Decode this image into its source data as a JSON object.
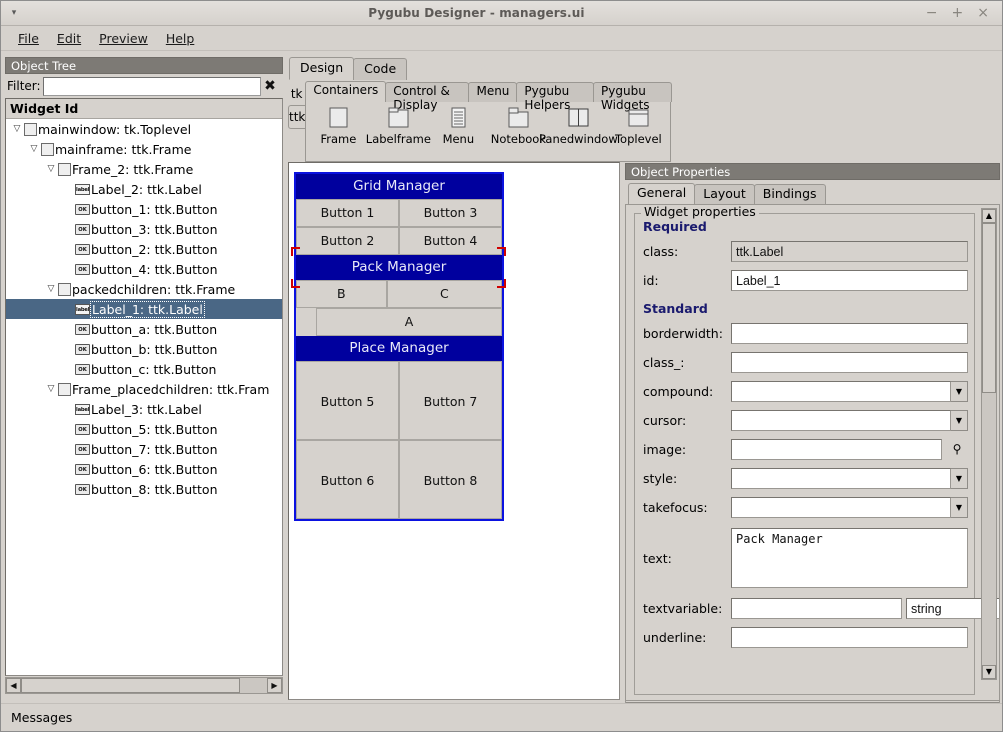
{
  "window": {
    "title": "Pygubu Designer - managers.ui",
    "controls": {
      "minimize": "−",
      "maximize": "+",
      "close": "×",
      "menu_caret": "▾"
    }
  },
  "menubar": {
    "items": [
      "File",
      "Edit",
      "Preview",
      "Help"
    ]
  },
  "object_tree": {
    "header": "Object Tree",
    "filter_label": "Filter:",
    "filter_value": "",
    "filter_placeholder": "",
    "clear_icon": "✖",
    "column_header": "Widget Id",
    "items": [
      {
        "label": "mainwindow: tk.Toplevel",
        "indent": 0,
        "twist": "▽",
        "icon": "frame",
        "selected": false
      },
      {
        "label": "mainframe: ttk.Frame",
        "indent": 1,
        "twist": "▽",
        "icon": "frame",
        "selected": false
      },
      {
        "label": "Frame_2: ttk.Frame",
        "indent": 2,
        "twist": "▽",
        "icon": "frame",
        "selected": false
      },
      {
        "label": "Label_2: ttk.Label",
        "indent": 3,
        "twist": "",
        "icon": "label",
        "selected": false
      },
      {
        "label": "button_1: ttk.Button",
        "indent": 3,
        "twist": "",
        "icon": "button",
        "selected": false
      },
      {
        "label": "button_3: ttk.Button",
        "indent": 3,
        "twist": "",
        "icon": "button",
        "selected": false
      },
      {
        "label": "button_2: ttk.Button",
        "indent": 3,
        "twist": "",
        "icon": "button",
        "selected": false
      },
      {
        "label": "button_4: ttk.Button",
        "indent": 3,
        "twist": "",
        "icon": "button",
        "selected": false
      },
      {
        "label": "packedchildren: ttk.Frame",
        "indent": 2,
        "twist": "▽",
        "icon": "frame",
        "selected": false
      },
      {
        "label": "Label_1: ttk.Label",
        "indent": 3,
        "twist": "",
        "icon": "label",
        "selected": true
      },
      {
        "label": "button_a: ttk.Button",
        "indent": 3,
        "twist": "",
        "icon": "button",
        "selected": false
      },
      {
        "label": "button_b: ttk.Button",
        "indent": 3,
        "twist": "",
        "icon": "button",
        "selected": false
      },
      {
        "label": "button_c: ttk.Button",
        "indent": 3,
        "twist": "",
        "icon": "button",
        "selected": false
      },
      {
        "label": "Frame_placedchildren: ttk.Fram",
        "indent": 2,
        "twist": "▽",
        "icon": "frame",
        "selected": false
      },
      {
        "label": "Label_3: ttk.Label",
        "indent": 3,
        "twist": "",
        "icon": "label",
        "selected": false
      },
      {
        "label": "button_5: ttk.Button",
        "indent": 3,
        "twist": "",
        "icon": "button",
        "selected": false
      },
      {
        "label": "button_7: ttk.Button",
        "indent": 3,
        "twist": "",
        "icon": "button",
        "selected": false
      },
      {
        "label": "button_6: ttk.Button",
        "indent": 3,
        "twist": "",
        "icon": "button",
        "selected": false
      },
      {
        "label": "button_8: ttk.Button",
        "indent": 3,
        "twist": "",
        "icon": "button",
        "selected": false
      }
    ],
    "icon_text": {
      "label": "label",
      "button": "OK"
    },
    "scroll_left_arrow": "◀",
    "scroll_right_arrow": "▶"
  },
  "design": {
    "tabs": [
      {
        "label": "Design",
        "active": true
      },
      {
        "label": "Code",
        "active": false
      }
    ],
    "toolkit_tabs": [
      {
        "label": "tk",
        "active": false
      },
      {
        "label": "ttk",
        "active": true
      }
    ],
    "palette_tabs": [
      {
        "label": "Containers",
        "active": true
      },
      {
        "label": "Control & Display",
        "active": false
      },
      {
        "label": "Menu",
        "active": false
      },
      {
        "label": "Pygubu Helpers",
        "active": false
      },
      {
        "label": "Pygubu Widgets",
        "active": false
      }
    ],
    "palette_items": [
      {
        "label": "Frame",
        "icon": "frame-icon"
      },
      {
        "label": "Labelframe",
        "icon": "labelframe-icon"
      },
      {
        "label": "Menu",
        "icon": "menu-icon"
      },
      {
        "label": "Notebook",
        "icon": "notebook-icon"
      },
      {
        "label": "Panedwindow",
        "icon": "panedwindow-icon"
      },
      {
        "label": "Toplevel",
        "icon": "toplevel-icon"
      }
    ],
    "canvas": {
      "selection_tag": "mainwindow",
      "grid_manager": {
        "title": "Grid Manager",
        "buttons": [
          "Button 1",
          "Button 3",
          "Button 2",
          "Button 4"
        ]
      },
      "pack_manager": {
        "title": "Pack Manager",
        "row1": [
          "B",
          "C"
        ],
        "row2": [
          "A"
        ]
      },
      "place_manager": {
        "title": "Place Manager",
        "buttons": [
          "Button 5",
          "Button 7",
          "Button 6",
          "Button 8"
        ]
      }
    },
    "colors": {
      "label_bg": "#00009e",
      "label_fg": "#e8e8f8",
      "widget_outline": "#0b12e0",
      "selection_marker": "#d00000"
    }
  },
  "properties": {
    "header": "Object Properties",
    "tabs": [
      {
        "label": "General",
        "active": true
      },
      {
        "label": "Layout",
        "active": false
      },
      {
        "label": "Bindings",
        "active": false
      }
    ],
    "group_legend": "Widget properties",
    "sections": {
      "required": "Required",
      "standard": "Standard"
    },
    "fields": [
      {
        "label": "class:",
        "value": "ttk.Label",
        "kind": "readonly"
      },
      {
        "label": "id:",
        "value": "Label_1",
        "kind": "text"
      },
      {
        "label": "borderwidth:",
        "value": "",
        "kind": "text"
      },
      {
        "label": "class_:",
        "value": "",
        "kind": "text"
      },
      {
        "label": "compound:",
        "value": "",
        "kind": "combo"
      },
      {
        "label": "cursor:",
        "value": "",
        "kind": "combo"
      },
      {
        "label": "image:",
        "value": "",
        "kind": "text-browse"
      },
      {
        "label": "style:",
        "value": "",
        "kind": "combo"
      },
      {
        "label": "takefocus:",
        "value": "",
        "kind": "combo"
      },
      {
        "label": "text:",
        "value": "Pack Manager",
        "kind": "textarea"
      },
      {
        "label": "textvariable:",
        "value": "",
        "kind": "text-type",
        "type_value": "string"
      },
      {
        "label": "underline:",
        "value": "",
        "kind": "text"
      }
    ],
    "browse_icon": "⚲",
    "combo_arrow": "▼",
    "scroll_up_arrow": "▲",
    "scroll_down_arrow": "▼",
    "scroll_left_arrow": "◀",
    "scroll_right_arrow": "▶"
  },
  "statusbar": {
    "text": "Messages"
  }
}
